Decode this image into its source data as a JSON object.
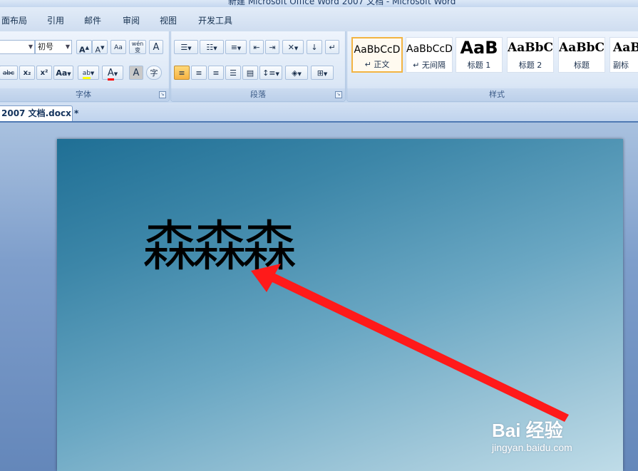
{
  "window": {
    "title": "新建 Microsoft Office Word 2007 文档 - Microsoft Word"
  },
  "menu": {
    "items": [
      "面布局",
      "引用",
      "邮件",
      "审阅",
      "视图",
      "开发工具"
    ]
  },
  "font_group": {
    "label": "字体",
    "size_value": "初号",
    "grow_label": "A",
    "shrink_label": "A",
    "clear_label": "Aa",
    "phonetic_label": "wén",
    "border_label": "A",
    "strike_label": "abc",
    "sub_label": "x₂",
    "sup_label": "x²",
    "case_label": "Aa",
    "highlight_label": "ab",
    "color_label": "A",
    "shade_label": "A",
    "enclose_label": "字"
  },
  "paragraph_group": {
    "label": "段落"
  },
  "styles_group": {
    "label": "样式",
    "items": [
      {
        "sample": "AaBbCcD",
        "name": "↵ 正文"
      },
      {
        "sample": "AaBbCcD",
        "name": "↵ 无间隔"
      },
      {
        "sample": "AaB",
        "name": "标题 1"
      },
      {
        "sample": "AaBbC",
        "name": "标题 2"
      },
      {
        "sample": "AaBbC",
        "name": "标题"
      },
      {
        "sample": "AaB",
        "name": "副标"
      }
    ]
  },
  "document": {
    "tab_label": "2007 文档.docx *",
    "content_text": "森森森",
    "arrow_color": "#ff1a1a"
  },
  "watermark": {
    "logo": "Bai 经验",
    "url": "jingyan.baidu.com"
  },
  "colors": {
    "highlight": "#ffff00",
    "font_color": "#ff0000",
    "active_button": "#f7b342"
  }
}
